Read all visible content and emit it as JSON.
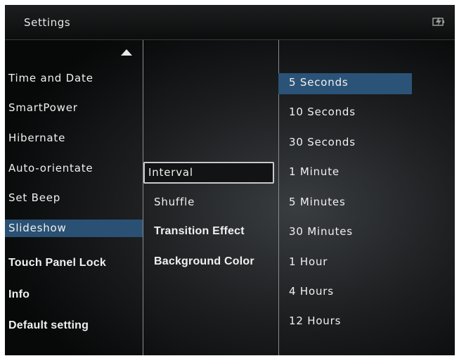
{
  "header": {
    "title": "Settings",
    "status_icon": "battery-charging-icon"
  },
  "left_menu": {
    "items": [
      "Time and Date",
      "SmartPower",
      "Hibernate",
      "Auto-orientate",
      "Set Beep",
      "Slideshow",
      "Touch Panel Lock",
      "Info",
      "Default setting"
    ],
    "selected": "Slideshow"
  },
  "middle_menu": {
    "items": [
      "Interval",
      "Shuffle",
      "Transition Effect",
      "Background Color"
    ],
    "selected": "Interval"
  },
  "right_menu": {
    "items": [
      "5 Seconds",
      "10 Seconds",
      "30 Seconds",
      "1 Minute",
      "5 Minutes",
      "30 Minutes",
      "1 Hour",
      "4 Hours",
      "12 Hours"
    ],
    "selected": "5 Seconds"
  },
  "colors": {
    "selection": "#2a5173",
    "focus_border": "#c7c9cb",
    "text": "#f0f0f0"
  }
}
